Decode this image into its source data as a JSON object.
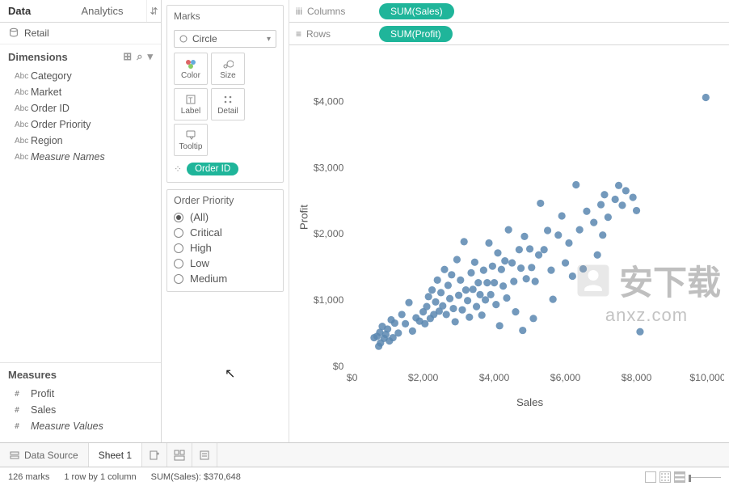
{
  "tabs": {
    "data": "Data",
    "analytics": "Analytics"
  },
  "datasource": "Retail",
  "dimensions": {
    "title": "Dimensions",
    "items": [
      {
        "type": "Abc",
        "label": "Category"
      },
      {
        "type": "Abc",
        "label": "Market"
      },
      {
        "type": "Abc",
        "label": "Order ID"
      },
      {
        "type": "Abc",
        "label": "Order Priority"
      },
      {
        "type": "Abc",
        "label": "Region"
      },
      {
        "type": "Abc",
        "label": "Measure Names",
        "italic": true
      }
    ]
  },
  "measures": {
    "title": "Measures",
    "items": [
      {
        "type": "#",
        "label": "Profit"
      },
      {
        "type": "#",
        "label": "Sales"
      },
      {
        "type": "#",
        "label": "Measure Values",
        "italic": true
      }
    ]
  },
  "marks": {
    "title": "Marks",
    "type_label": "Circle",
    "buttons": {
      "color": "Color",
      "size": "Size",
      "label": "Label",
      "detail": "Detail",
      "tooltip": "Tooltip"
    },
    "detail_pill": "Order ID"
  },
  "filter": {
    "title": "Order Priority",
    "options": [
      "(All)",
      "Critical",
      "High",
      "Low",
      "Medium"
    ],
    "selected": 0
  },
  "shelves": {
    "columns_label": "Columns",
    "columns_pill": "SUM(Sales)",
    "rows_label": "Rows",
    "rows_pill": "SUM(Profit)"
  },
  "sheet_tabs": {
    "data_source": "Data Source",
    "sheet1": "Sheet 1"
  },
  "status": {
    "marks": "126 marks",
    "grid": "1 row by 1 column",
    "sum": "SUM(Sales): $370,648"
  },
  "watermark": {
    "cn": "安下载",
    "url": "anxz.com"
  },
  "chart_data": {
    "type": "scatter",
    "xlabel": "Sales",
    "ylabel": "Profit",
    "xlim": [
      0,
      10000
    ],
    "ylim": [
      0,
      4500
    ],
    "x_ticks": [
      0,
      2000,
      4000,
      6000,
      8000,
      10000
    ],
    "y_ticks": [
      0,
      1000,
      2000,
      3000,
      4000
    ],
    "x_tick_labels": [
      "$0",
      "$2,000",
      "$4,000",
      "$6,000",
      "$8,000",
      "$10,000"
    ],
    "y_tick_labels": [
      "$0",
      "$1,000",
      "$2,000",
      "$3,000",
      "$4,000"
    ],
    "points": [
      [
        620,
        430
      ],
      [
        700,
        450
      ],
      [
        750,
        300
      ],
      [
        780,
        510
      ],
      [
        800,
        350
      ],
      [
        850,
        600
      ],
      [
        900,
        420
      ],
      [
        950,
        480
      ],
      [
        1000,
        560
      ],
      [
        1050,
        380
      ],
      [
        1100,
        700
      ],
      [
        1150,
        430
      ],
      [
        1200,
        650
      ],
      [
        1300,
        500
      ],
      [
        1400,
        780
      ],
      [
        1500,
        640
      ],
      [
        1600,
        960
      ],
      [
        1700,
        530
      ],
      [
        1800,
        730
      ],
      [
        1900,
        680
      ],
      [
        2000,
        820
      ],
      [
        2050,
        640
      ],
      [
        2100,
        900
      ],
      [
        2150,
        1050
      ],
      [
        2200,
        720
      ],
      [
        2250,
        1150
      ],
      [
        2300,
        780
      ],
      [
        2350,
        970
      ],
      [
        2400,
        1300
      ],
      [
        2450,
        830
      ],
      [
        2500,
        1110
      ],
      [
        2550,
        910
      ],
      [
        2600,
        1460
      ],
      [
        2650,
        780
      ],
      [
        2700,
        1220
      ],
      [
        2750,
        1020
      ],
      [
        2800,
        1380
      ],
      [
        2850,
        870
      ],
      [
        2900,
        670
      ],
      [
        2950,
        1610
      ],
      [
        3000,
        1070
      ],
      [
        3050,
        1300
      ],
      [
        3100,
        850
      ],
      [
        3150,
        1880
      ],
      [
        3200,
        1150
      ],
      [
        3250,
        990
      ],
      [
        3300,
        740
      ],
      [
        3350,
        1410
      ],
      [
        3400,
        1160
      ],
      [
        3450,
        1570
      ],
      [
        3500,
        900
      ],
      [
        3550,
        1260
      ],
      [
        3600,
        1080
      ],
      [
        3650,
        770
      ],
      [
        3700,
        1450
      ],
      [
        3750,
        1000
      ],
      [
        3800,
        1260
      ],
      [
        3850,
        1860
      ],
      [
        3900,
        1080
      ],
      [
        3950,
        1510
      ],
      [
        4000,
        1260
      ],
      [
        4050,
        930
      ],
      [
        4100,
        1710
      ],
      [
        4150,
        610
      ],
      [
        4200,
        1460
      ],
      [
        4250,
        1210
      ],
      [
        4300,
        1590
      ],
      [
        4350,
        1030
      ],
      [
        4400,
        2060
      ],
      [
        4500,
        1560
      ],
      [
        4550,
        1280
      ],
      [
        4600,
        820
      ],
      [
        4700,
        1760
      ],
      [
        4750,
        1480
      ],
      [
        4800,
        540
      ],
      [
        4850,
        1960
      ],
      [
        4900,
        1320
      ],
      [
        5000,
        1770
      ],
      [
        5050,
        1490
      ],
      [
        5100,
        720
      ],
      [
        5150,
        1280
      ],
      [
        5250,
        1680
      ],
      [
        5300,
        2460
      ],
      [
        5400,
        1760
      ],
      [
        5500,
        2050
      ],
      [
        5600,
        1450
      ],
      [
        5650,
        1010
      ],
      [
        5800,
        1980
      ],
      [
        5900,
        2270
      ],
      [
        6000,
        1560
      ],
      [
        6100,
        1860
      ],
      [
        6200,
        1360
      ],
      [
        6300,
        2740
      ],
      [
        6400,
        2060
      ],
      [
        6500,
        1470
      ],
      [
        6600,
        2340
      ],
      [
        6800,
        2170
      ],
      [
        6900,
        1680
      ],
      [
        7000,
        2440
      ],
      [
        7050,
        1980
      ],
      [
        7100,
        2590
      ],
      [
        7200,
        2250
      ],
      [
        7400,
        2520
      ],
      [
        7500,
        2730
      ],
      [
        7600,
        2430
      ],
      [
        7700,
        2650
      ],
      [
        7900,
        2550
      ],
      [
        8000,
        2350
      ],
      [
        8100,
        520
      ],
      [
        9950,
        4060
      ]
    ]
  }
}
